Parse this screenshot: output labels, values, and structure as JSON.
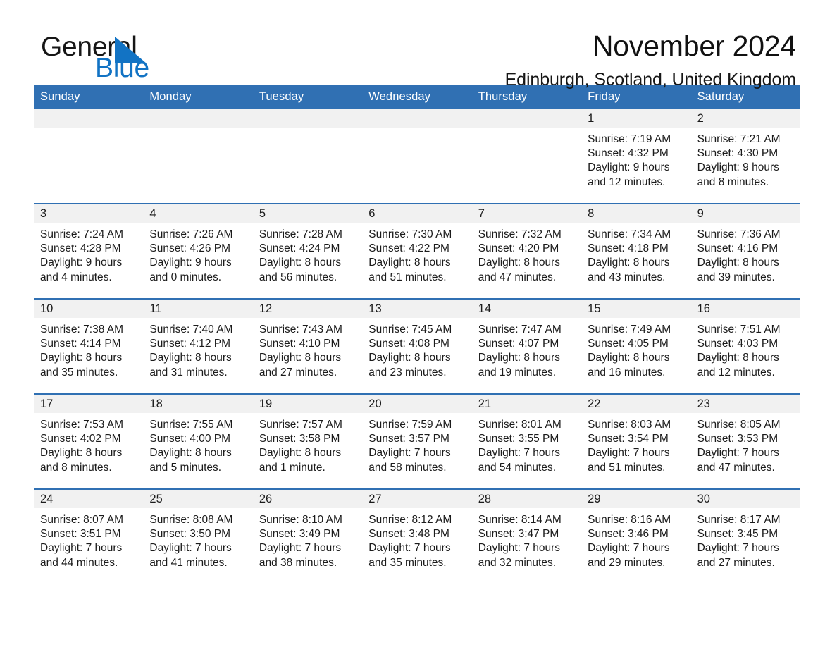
{
  "brand": {
    "name_part1": "General",
    "name_part2": "Blue",
    "triangle_icon": "brand-triangle-icon",
    "color_dark": "#161616",
    "color_blue": "#1273c4"
  },
  "header": {
    "title": "November 2024",
    "subtitle": "Edinburgh, Scotland, United Kingdom"
  },
  "theme": {
    "header_blue": "#3070b3",
    "day_band_gray": "#f1f1f1",
    "text": "#1b1b1b"
  },
  "weekdays": [
    "Sunday",
    "Monday",
    "Tuesday",
    "Wednesday",
    "Thursday",
    "Friday",
    "Saturday"
  ],
  "weeks": [
    [
      {
        "day": "",
        "sunrise": "",
        "sunset": "",
        "daylight1": "",
        "daylight2": ""
      },
      {
        "day": "",
        "sunrise": "",
        "sunset": "",
        "daylight1": "",
        "daylight2": ""
      },
      {
        "day": "",
        "sunrise": "",
        "sunset": "",
        "daylight1": "",
        "daylight2": ""
      },
      {
        "day": "",
        "sunrise": "",
        "sunset": "",
        "daylight1": "",
        "daylight2": ""
      },
      {
        "day": "",
        "sunrise": "",
        "sunset": "",
        "daylight1": "",
        "daylight2": ""
      },
      {
        "day": "1",
        "sunrise": "Sunrise: 7:19 AM",
        "sunset": "Sunset: 4:32 PM",
        "daylight1": "Daylight: 9 hours",
        "daylight2": "and 12 minutes."
      },
      {
        "day": "2",
        "sunrise": "Sunrise: 7:21 AM",
        "sunset": "Sunset: 4:30 PM",
        "daylight1": "Daylight: 9 hours",
        "daylight2": "and 8 minutes."
      }
    ],
    [
      {
        "day": "3",
        "sunrise": "Sunrise: 7:24 AM",
        "sunset": "Sunset: 4:28 PM",
        "daylight1": "Daylight: 9 hours",
        "daylight2": "and 4 minutes."
      },
      {
        "day": "4",
        "sunrise": "Sunrise: 7:26 AM",
        "sunset": "Sunset: 4:26 PM",
        "daylight1": "Daylight: 9 hours",
        "daylight2": "and 0 minutes."
      },
      {
        "day": "5",
        "sunrise": "Sunrise: 7:28 AM",
        "sunset": "Sunset: 4:24 PM",
        "daylight1": "Daylight: 8 hours",
        "daylight2": "and 56 minutes."
      },
      {
        "day": "6",
        "sunrise": "Sunrise: 7:30 AM",
        "sunset": "Sunset: 4:22 PM",
        "daylight1": "Daylight: 8 hours",
        "daylight2": "and 51 minutes."
      },
      {
        "day": "7",
        "sunrise": "Sunrise: 7:32 AM",
        "sunset": "Sunset: 4:20 PM",
        "daylight1": "Daylight: 8 hours",
        "daylight2": "and 47 minutes."
      },
      {
        "day": "8",
        "sunrise": "Sunrise: 7:34 AM",
        "sunset": "Sunset: 4:18 PM",
        "daylight1": "Daylight: 8 hours",
        "daylight2": "and 43 minutes."
      },
      {
        "day": "9",
        "sunrise": "Sunrise: 7:36 AM",
        "sunset": "Sunset: 4:16 PM",
        "daylight1": "Daylight: 8 hours",
        "daylight2": "and 39 minutes."
      }
    ],
    [
      {
        "day": "10",
        "sunrise": "Sunrise: 7:38 AM",
        "sunset": "Sunset: 4:14 PM",
        "daylight1": "Daylight: 8 hours",
        "daylight2": "and 35 minutes."
      },
      {
        "day": "11",
        "sunrise": "Sunrise: 7:40 AM",
        "sunset": "Sunset: 4:12 PM",
        "daylight1": "Daylight: 8 hours",
        "daylight2": "and 31 minutes."
      },
      {
        "day": "12",
        "sunrise": "Sunrise: 7:43 AM",
        "sunset": "Sunset: 4:10 PM",
        "daylight1": "Daylight: 8 hours",
        "daylight2": "and 27 minutes."
      },
      {
        "day": "13",
        "sunrise": "Sunrise: 7:45 AM",
        "sunset": "Sunset: 4:08 PM",
        "daylight1": "Daylight: 8 hours",
        "daylight2": "and 23 minutes."
      },
      {
        "day": "14",
        "sunrise": "Sunrise: 7:47 AM",
        "sunset": "Sunset: 4:07 PM",
        "daylight1": "Daylight: 8 hours",
        "daylight2": "and 19 minutes."
      },
      {
        "day": "15",
        "sunrise": "Sunrise: 7:49 AM",
        "sunset": "Sunset: 4:05 PM",
        "daylight1": "Daylight: 8 hours",
        "daylight2": "and 16 minutes."
      },
      {
        "day": "16",
        "sunrise": "Sunrise: 7:51 AM",
        "sunset": "Sunset: 4:03 PM",
        "daylight1": "Daylight: 8 hours",
        "daylight2": "and 12 minutes."
      }
    ],
    [
      {
        "day": "17",
        "sunrise": "Sunrise: 7:53 AM",
        "sunset": "Sunset: 4:02 PM",
        "daylight1": "Daylight: 8 hours",
        "daylight2": "and 8 minutes."
      },
      {
        "day": "18",
        "sunrise": "Sunrise: 7:55 AM",
        "sunset": "Sunset: 4:00 PM",
        "daylight1": "Daylight: 8 hours",
        "daylight2": "and 5 minutes."
      },
      {
        "day": "19",
        "sunrise": "Sunrise: 7:57 AM",
        "sunset": "Sunset: 3:58 PM",
        "daylight1": "Daylight: 8 hours",
        "daylight2": "and 1 minute."
      },
      {
        "day": "20",
        "sunrise": "Sunrise: 7:59 AM",
        "sunset": "Sunset: 3:57 PM",
        "daylight1": "Daylight: 7 hours",
        "daylight2": "and 58 minutes."
      },
      {
        "day": "21",
        "sunrise": "Sunrise: 8:01 AM",
        "sunset": "Sunset: 3:55 PM",
        "daylight1": "Daylight: 7 hours",
        "daylight2": "and 54 minutes."
      },
      {
        "day": "22",
        "sunrise": "Sunrise: 8:03 AM",
        "sunset": "Sunset: 3:54 PM",
        "daylight1": "Daylight: 7 hours",
        "daylight2": "and 51 minutes."
      },
      {
        "day": "23",
        "sunrise": "Sunrise: 8:05 AM",
        "sunset": "Sunset: 3:53 PM",
        "daylight1": "Daylight: 7 hours",
        "daylight2": "and 47 minutes."
      }
    ],
    [
      {
        "day": "24",
        "sunrise": "Sunrise: 8:07 AM",
        "sunset": "Sunset: 3:51 PM",
        "daylight1": "Daylight: 7 hours",
        "daylight2": "and 44 minutes."
      },
      {
        "day": "25",
        "sunrise": "Sunrise: 8:08 AM",
        "sunset": "Sunset: 3:50 PM",
        "daylight1": "Daylight: 7 hours",
        "daylight2": "and 41 minutes."
      },
      {
        "day": "26",
        "sunrise": "Sunrise: 8:10 AM",
        "sunset": "Sunset: 3:49 PM",
        "daylight1": "Daylight: 7 hours",
        "daylight2": "and 38 minutes."
      },
      {
        "day": "27",
        "sunrise": "Sunrise: 8:12 AM",
        "sunset": "Sunset: 3:48 PM",
        "daylight1": "Daylight: 7 hours",
        "daylight2": "and 35 minutes."
      },
      {
        "day": "28",
        "sunrise": "Sunrise: 8:14 AM",
        "sunset": "Sunset: 3:47 PM",
        "daylight1": "Daylight: 7 hours",
        "daylight2": "and 32 minutes."
      },
      {
        "day": "29",
        "sunrise": "Sunrise: 8:16 AM",
        "sunset": "Sunset: 3:46 PM",
        "daylight1": "Daylight: 7 hours",
        "daylight2": "and 29 minutes."
      },
      {
        "day": "30",
        "sunrise": "Sunrise: 8:17 AM",
        "sunset": "Sunset: 3:45 PM",
        "daylight1": "Daylight: 7 hours",
        "daylight2": "and 27 minutes."
      }
    ]
  ]
}
